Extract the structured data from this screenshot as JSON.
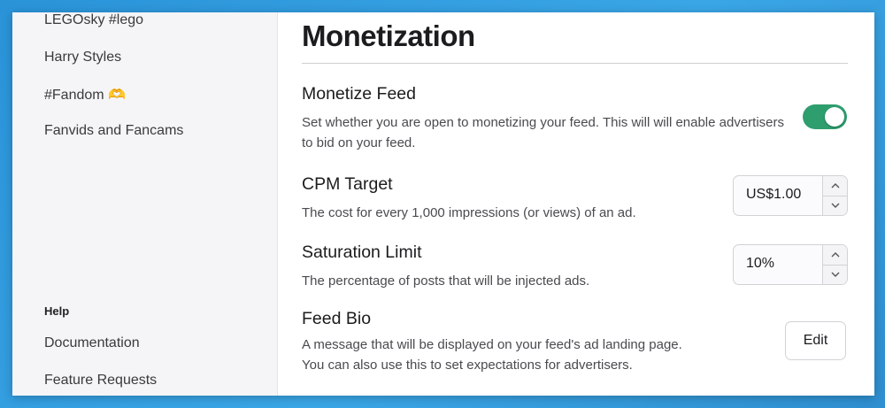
{
  "sidebar": {
    "items": [
      {
        "label": "LEGOsky #lego"
      },
      {
        "label": "Harry Styles"
      },
      {
        "label": "#Fandom 🫶"
      },
      {
        "label": "Fanvids and Fancams"
      }
    ],
    "help_heading": "Help",
    "help_items": [
      {
        "label": "Documentation"
      },
      {
        "label": "Feature Requests"
      }
    ]
  },
  "main": {
    "title": "Monetization",
    "monetize": {
      "title": "Monetize Feed",
      "description": "Set whether you are open to monetizing your feed. This will will enable advertisers to bid on your feed.",
      "enabled": true
    },
    "cpm": {
      "title": "CPM Target",
      "description": "The cost for every 1,000 impressions (or views) of an ad.",
      "value": "US$1.00"
    },
    "saturation": {
      "title": "Saturation Limit",
      "description": "The percentage of posts that will be injected ads.",
      "value": "10%"
    },
    "bio": {
      "title": "Feed Bio",
      "description_line1": "A message that will be displayed on your feed's ad landing page.",
      "description_line2": "You can also use this to set expectations for advertisers.",
      "edit_label": "Edit"
    }
  },
  "colors": {
    "toggle_on": "#2e9e6e",
    "background_gradient": "#2a93d8"
  },
  "icons": {
    "stepper_up": "chevron-up-icon",
    "stepper_down": "chevron-down-icon"
  }
}
